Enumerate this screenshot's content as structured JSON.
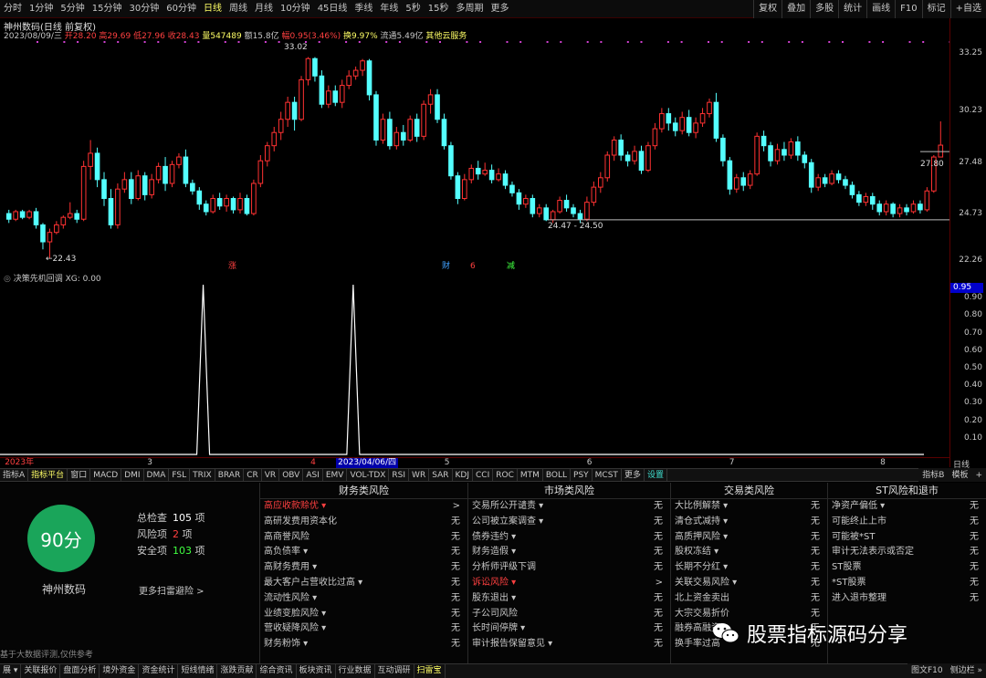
{
  "toolbar": {
    "periods": [
      "分时",
      "1分钟",
      "5分钟",
      "15分钟",
      "30分钟",
      "60分钟",
      "日线",
      "周线",
      "月线",
      "10分钟",
      "45日线",
      "季线",
      "年线",
      "5秒",
      "15秒",
      "多周期",
      "更多"
    ],
    "active_period": "日线",
    "right": [
      "复权",
      "叠加",
      "多股",
      "统计",
      "画线",
      "F10",
      "标记",
      "+自选"
    ]
  },
  "title": "神州数码(日线 前复权)",
  "quote": {
    "date": "2023/08/09/三",
    "open": "开28.20",
    "high": "高29.69",
    "low": "低27.96",
    "close": "收28.43",
    "volume": "量547489",
    "amount": "额15.8亿",
    "change": "幅0.95(3.46%)",
    "turnover": "换9.97%",
    "float_cap": "流通5.49亿",
    "extra": "其他云服务"
  },
  "main_chart": {
    "y_labels": [
      "33.25",
      "30.23",
      "27.48",
      "24.73",
      "22.26"
    ],
    "annotations": {
      "high": "33.02",
      "low": "←22.43",
      "range": "24.47 - 24.50",
      "last": "27.80"
    },
    "event_marks": [
      {
        "text": "涨",
        "color": "#ff4040"
      },
      {
        "text": "财",
        "color": "#40a0ff"
      },
      {
        "text": "6",
        "color": "#ff4040"
      },
      {
        "text": "减",
        "color": "#40ff40"
      }
    ],
    "candles": [
      [
        24.8,
        24.5,
        25.0,
        24.3
      ],
      [
        24.5,
        24.9,
        25.0,
        24.4
      ],
      [
        24.9,
        24.6,
        25.0,
        24.5
      ],
      [
        24.6,
        24.9,
        25.0,
        24.5
      ],
      [
        24.9,
        24.2,
        25.1,
        24.0
      ],
      [
        24.2,
        23.3,
        24.3,
        22.9
      ],
      [
        23.3,
        23.8,
        24.0,
        22.43
      ],
      [
        23.8,
        24.2,
        24.4,
        23.7
      ],
      [
        24.2,
        24.6,
        24.7,
        24.0
      ],
      [
        24.6,
        24.8,
        25.4,
        24.5
      ],
      [
        24.8,
        24.5,
        25.0,
        24.3
      ],
      [
        24.5,
        27.3,
        27.6,
        24.4
      ],
      [
        27.3,
        28.0,
        28.7,
        26.6
      ],
      [
        28.0,
        26.6,
        28.3,
        26.2
      ],
      [
        26.6,
        25.6,
        27.0,
        25.2
      ],
      [
        25.6,
        24.2,
        26.1,
        24.0
      ],
      [
        24.2,
        26.1,
        26.4,
        24.0
      ],
      [
        26.1,
        26.6,
        27.0,
        25.9
      ],
      [
        26.6,
        25.6,
        27.0,
        25.3
      ],
      [
        25.6,
        26.8,
        27.1,
        25.5
      ],
      [
        26.8,
        25.8,
        27.0,
        25.5
      ],
      [
        25.8,
        26.6,
        26.9,
        25.6
      ],
      [
        26.6,
        27.3,
        27.5,
        26.4
      ],
      [
        27.3,
        26.4,
        27.8,
        26.0
      ],
      [
        26.4,
        27.4,
        27.6,
        26.2
      ],
      [
        27.4,
        27.8,
        28.0,
        27.2
      ],
      [
        27.8,
        26.4,
        28.2,
        26.2
      ],
      [
        26.4,
        26.0,
        26.6,
        25.8
      ],
      [
        26.0,
        25.3,
        26.2,
        25.0
      ],
      [
        25.3,
        24.9,
        25.5,
        24.7
      ],
      [
        24.9,
        25.6,
        25.8,
        24.8
      ],
      [
        25.6,
        25.2,
        25.9,
        25.0
      ],
      [
        25.2,
        25.6,
        25.8,
        24.9
      ],
      [
        25.6,
        25.0,
        25.7,
        24.8
      ],
      [
        25.0,
        25.6,
        25.9,
        24.8
      ],
      [
        25.6,
        24.8,
        25.8,
        24.7
      ],
      [
        24.8,
        26.4,
        26.6,
        24.7
      ],
      [
        26.4,
        27.6,
        27.9,
        26.2
      ],
      [
        27.6,
        28.4,
        28.6,
        27.3
      ],
      [
        28.4,
        29.1,
        29.4,
        28.1
      ],
      [
        29.1,
        29.8,
        30.2,
        28.7
      ],
      [
        29.8,
        30.7,
        31.0,
        29.4
      ],
      [
        30.7,
        29.8,
        31.0,
        29.2
      ],
      [
        29.8,
        31.9,
        32.1,
        29.7
      ],
      [
        31.9,
        33.02,
        33.1,
        31.6
      ],
      [
        33.02,
        32.1,
        33.1,
        31.8
      ],
      [
        32.1,
        30.6,
        32.4,
        30.4
      ],
      [
        30.6,
        31.3,
        31.6,
        30.4
      ],
      [
        31.3,
        30.7,
        31.6,
        30.5
      ],
      [
        30.7,
        31.6,
        31.9,
        30.4
      ],
      [
        31.6,
        32.1,
        32.4,
        31.4
      ],
      [
        32.1,
        32.4,
        32.6,
        31.9
      ],
      [
        32.4,
        32.9,
        33.0,
        32.1
      ],
      [
        32.9,
        31.1,
        33.0,
        30.8
      ],
      [
        31.1,
        28.7,
        31.3,
        28.4
      ],
      [
        28.7,
        29.8,
        30.1,
        28.5
      ],
      [
        29.8,
        28.4,
        30.2,
        28.2
      ],
      [
        28.4,
        29.1,
        29.4,
        28.2
      ],
      [
        29.1,
        28.7,
        29.5,
        28.4
      ],
      [
        28.7,
        29.8,
        30.0,
        28.6
      ],
      [
        29.8,
        28.9,
        30.1,
        28.6
      ],
      [
        28.9,
        30.6,
        30.8,
        28.7
      ],
      [
        30.6,
        31.1,
        31.4,
        30.1
      ],
      [
        31.1,
        29.8,
        31.4,
        29.6
      ],
      [
        29.8,
        28.4,
        30.1,
        28.2
      ],
      [
        28.4,
        26.8,
        28.6,
        26.6
      ],
      [
        26.8,
        25.6,
        27.0,
        25.3
      ],
      [
        25.6,
        26.6,
        26.9,
        25.5
      ],
      [
        26.6,
        27.2,
        27.4,
        26.4
      ],
      [
        27.2,
        26.9,
        27.6,
        26.6
      ],
      [
        26.9,
        27.1,
        27.5,
        26.8
      ],
      [
        27.1,
        26.6,
        27.4,
        26.4
      ],
      [
        26.6,
        26.9,
        27.2,
        26.5
      ],
      [
        26.9,
        26.3,
        27.1,
        26.1
      ],
      [
        26.3,
        25.9,
        26.5,
        25.7
      ],
      [
        25.9,
        25.3,
        26.1,
        25.0
      ],
      [
        25.3,
        25.6,
        25.8,
        25.1
      ],
      [
        25.6,
        24.8,
        25.8,
        24.6
      ],
      [
        24.8,
        25.1,
        25.3,
        24.6
      ],
      [
        25.1,
        24.47,
        25.3,
        24.4
      ],
      [
        24.47,
        24.9,
        25.0,
        24.3
      ],
      [
        24.9,
        25.5,
        25.7,
        24.8
      ],
      [
        25.5,
        25.1,
        25.8,
        24.9
      ],
      [
        25.1,
        24.8,
        25.3,
        24.6
      ],
      [
        24.8,
        24.5,
        25.0,
        24.3
      ],
      [
        24.5,
        25.4,
        25.7,
        24.4
      ],
      [
        25.4,
        26.2,
        26.5,
        25.2
      ],
      [
        26.2,
        26.7,
        27.0,
        25.9
      ],
      [
        26.7,
        27.9,
        28.1,
        26.5
      ],
      [
        27.9,
        28.7,
        28.9,
        27.6
      ],
      [
        28.7,
        27.9,
        29.0,
        27.6
      ],
      [
        27.9,
        27.6,
        28.1,
        27.3
      ],
      [
        27.6,
        28.1,
        28.4,
        27.4
      ],
      [
        28.1,
        27.1,
        28.4,
        26.9
      ],
      [
        27.1,
        28.4,
        28.6,
        27.0
      ],
      [
        28.4,
        29.3,
        29.6,
        28.2
      ],
      [
        29.3,
        30.1,
        30.4,
        29.1
      ],
      [
        30.1,
        29.6,
        30.4,
        29.2
      ],
      [
        29.6,
        29.2,
        29.9,
        28.9
      ],
      [
        29.2,
        29.9,
        30.2,
        29.0
      ],
      [
        29.9,
        29.1,
        30.3,
        28.9
      ],
      [
        29.1,
        29.6,
        29.9,
        28.8
      ],
      [
        29.6,
        30.1,
        30.4,
        29.4
      ],
      [
        30.1,
        30.7,
        30.9,
        29.9
      ],
      [
        30.7,
        28.8,
        31.2,
        28.6
      ],
      [
        28.8,
        27.6,
        29.0,
        27.3
      ],
      [
        27.6,
        26.1,
        27.8,
        25.8
      ],
      [
        26.1,
        26.7,
        26.9,
        25.9
      ],
      [
        26.7,
        26.3,
        27.0,
        26.0
      ],
      [
        26.3,
        26.9,
        27.1,
        26.1
      ],
      [
        26.9,
        28.9,
        29.1,
        26.8
      ],
      [
        28.9,
        28.4,
        29.2,
        28.1
      ],
      [
        28.4,
        27.6,
        28.6,
        27.3
      ],
      [
        27.6,
        28.2,
        28.5,
        27.4
      ],
      [
        28.2,
        27.9,
        28.6,
        27.6
      ],
      [
        27.9,
        28.6,
        28.8,
        27.7
      ],
      [
        28.6,
        27.9,
        28.9,
        27.6
      ],
      [
        27.9,
        27.5,
        28.1,
        27.2
      ],
      [
        27.5,
        26.2,
        27.7,
        25.9
      ],
      [
        26.2,
        26.7,
        26.9,
        26.0
      ],
      [
        26.7,
        26.4,
        26.9,
        26.2
      ],
      [
        26.4,
        26.9,
        27.1,
        26.3
      ],
      [
        26.9,
        26.6,
        27.1,
        26.4
      ],
      [
        26.6,
        26.3,
        26.8,
        26.1
      ],
      [
        26.3,
        25.8,
        26.5,
        25.6
      ],
      [
        25.8,
        25.4,
        26.0,
        25.2
      ],
      [
        25.4,
        25.7,
        25.9,
        25.2
      ],
      [
        25.7,
        25.3,
        25.9,
        25.0
      ],
      [
        25.3,
        24.9,
        25.5,
        24.7
      ],
      [
        24.9,
        25.3,
        25.5,
        24.7
      ],
      [
        25.3,
        24.8,
        25.4,
        24.6
      ],
      [
        24.8,
        25.1,
        25.3,
        24.6
      ],
      [
        25.1,
        24.9,
        25.3,
        24.7
      ],
      [
        24.9,
        25.3,
        25.5,
        24.8
      ],
      [
        25.3,
        25.0,
        25.5,
        24.8
      ],
      [
        25.0,
        26.0,
        26.2,
        24.9
      ],
      [
        26.0,
        27.8,
        27.9,
        25.9
      ],
      [
        27.8,
        28.43,
        29.69,
        27.96
      ]
    ]
  },
  "sub_chart": {
    "title": "决策先机回调 XG: 0.00",
    "y_labels": [
      "0.95",
      "0.90",
      "0.80",
      "0.70",
      "0.60",
      "0.50",
      "0.40",
      "0.30",
      "0.20",
      "0.10"
    ],
    "current": "0.95",
    "signals": [
      {
        "x": 0.214
      },
      {
        "x": 0.372
      }
    ]
  },
  "date_axis": {
    "labels": [
      {
        "text": "2023年",
        "x": 0.005,
        "style": "red"
      },
      {
        "text": "3",
        "x": 0.155,
        "style": ""
      },
      {
        "text": "4",
        "x": 0.327,
        "style": "red"
      },
      {
        "text": "2023/04/06/四",
        "x": 0.354,
        "style": "hl"
      },
      {
        "text": "5",
        "x": 0.468,
        "style": ""
      },
      {
        "text": "6",
        "x": 0.618,
        "style": ""
      },
      {
        "text": "7",
        "x": 0.768,
        "style": ""
      },
      {
        "text": "8",
        "x": 0.927,
        "style": ""
      }
    ],
    "right": "日线"
  },
  "indicator_bar": {
    "items": [
      "指标A",
      "指标平台",
      "窗口",
      "MACD",
      "DMI",
      "DMA",
      "FSL",
      "TRIX",
      "BRAR",
      "CR",
      "VR",
      "OBV",
      "ASI",
      "EMV",
      "VOL-TDX",
      "RSI",
      "WR",
      "SAR",
      "KDJ",
      "CCI",
      "ROC",
      "MTM",
      "BOLL",
      "PSY",
      "MCST",
      "更多",
      "设置"
    ],
    "active": "指标平台",
    "right": [
      "指标B",
      "模板",
      "+"
    ]
  },
  "risk": {
    "score": "90分",
    "company": "神州数码",
    "total_label": "总检查",
    "total_value": "105",
    "total_unit": "项",
    "risk_label": "风险项",
    "risk_value": "2",
    "risk_unit": "项",
    "safe_label": "安全项",
    "safe_value": "103",
    "safe_unit": "项",
    "more": "更多扫雷避险 >",
    "disclaimer": "基于大数据评测,仅供参考",
    "columns": [
      {
        "title": "财务类风险",
        "rows": [
          {
            "label": "高应收款赊优 ▾",
            "value": ">",
            "red": true
          },
          {
            "label": "高研发费用资本化",
            "value": "无"
          },
          {
            "label": "高商誉风险",
            "value": "无"
          },
          {
            "label": "高负债率 ▾",
            "value": "无"
          },
          {
            "label": "高财务费用 ▾",
            "value": "无"
          },
          {
            "label": "最大客户占营收比过高 ▾",
            "value": "无"
          },
          {
            "label": "流动性风险 ▾",
            "value": "无"
          },
          {
            "label": "业绩变脸风险 ▾",
            "value": "无"
          },
          {
            "label": "营收疑降风险 ▾",
            "value": "无"
          },
          {
            "label": "财务粉饰 ▾",
            "value": "无"
          }
        ]
      },
      {
        "title": "市场类风险",
        "rows": [
          {
            "label": "交易所公开谴责 ▾",
            "value": "无"
          },
          {
            "label": "公司被立案调查 ▾",
            "value": "无"
          },
          {
            "label": "债券违约 ▾",
            "value": "无"
          },
          {
            "label": "财务造假 ▾",
            "value": "无"
          },
          {
            "label": "分析师评级下调",
            "value": "无"
          },
          {
            "label": "诉讼风险 ▾",
            "value": ">",
            "red": true
          },
          {
            "label": "股东退出 ▾",
            "value": "无"
          },
          {
            "label": "子公司风险",
            "value": "无"
          },
          {
            "label": "长时间停牌 ▾",
            "value": "无"
          },
          {
            "label": "审计报告保留意见 ▾",
            "value": "无"
          }
        ]
      },
      {
        "title": "交易类风险",
        "rows": [
          {
            "label": "大比例解禁 ▾",
            "value": "无"
          },
          {
            "label": "清仓式减持 ▾",
            "value": "无"
          },
          {
            "label": "高质押风险 ▾",
            "value": "无"
          },
          {
            "label": "股权冻结 ▾",
            "value": "无"
          },
          {
            "label": "长期不分红 ▾",
            "value": "无"
          },
          {
            "label": "关联交易风险 ▾",
            "value": "无"
          },
          {
            "label": "北上资金卖出",
            "value": "无"
          },
          {
            "label": "大宗交易折价",
            "value": "无"
          },
          {
            "label": "融券高融资",
            "value": "无"
          },
          {
            "label": "换手率过高",
            "value": "无"
          }
        ]
      },
      {
        "title": "ST风险和退市",
        "rows": [
          {
            "label": "净资产偏低 ▾",
            "value": "无"
          },
          {
            "label": "可能终止上市",
            "value": "无"
          },
          {
            "label": "可能被*ST",
            "value": "无"
          },
          {
            "label": "审计无法表示或否定",
            "value": "无"
          },
          {
            "label": "ST股票",
            "value": "无"
          },
          {
            "label": "*ST股票",
            "value": "无"
          },
          {
            "label": "进入退市整理",
            "value": "无"
          }
        ]
      }
    ]
  },
  "watermark": "股票指标源码分享",
  "bottom_bar": {
    "items": [
      "展 ▾",
      "关联报价",
      "盘面分析",
      "境外资金",
      "资金统计",
      "短线情绪",
      "涨跌贡献",
      "综合资讯",
      "板块资讯",
      "行业数据",
      "互动调研",
      "扫雷宝"
    ],
    "active": "扫雷宝",
    "right": [
      "图文F10",
      "侧边栏 »"
    ]
  },
  "colors": {
    "up": "#ff3232",
    "down": "#54ffff",
    "panel_border": "#5a0000"
  }
}
